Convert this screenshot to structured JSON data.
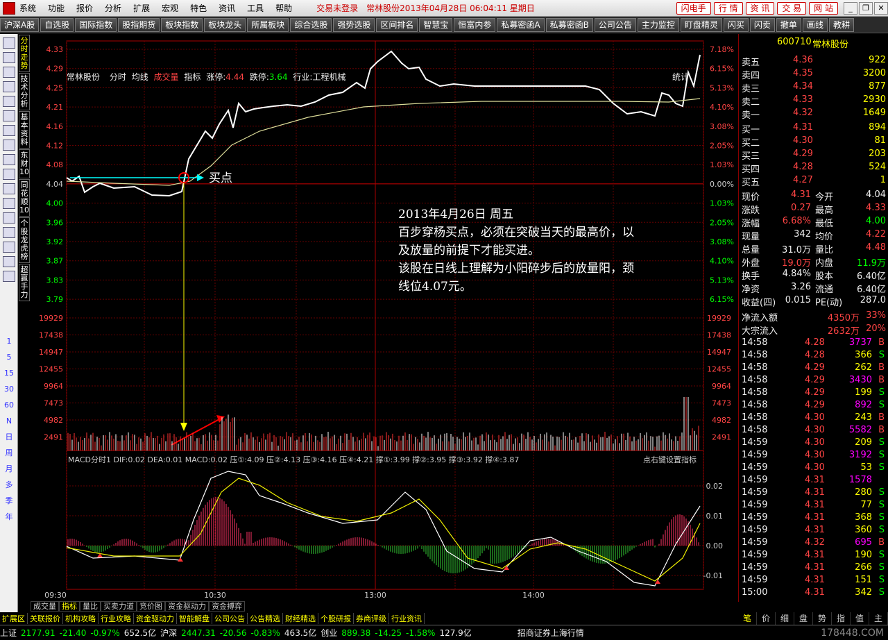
{
  "menu": [
    "系统",
    "功能",
    "报价",
    "分析",
    "扩展",
    "宏观",
    "特色",
    "资讯",
    "工具",
    "帮助"
  ],
  "status": "交易未登录",
  "window_title": "常林股份2013年04月28日 06:04:11 星期日",
  "quick_buttons": [
    "闪电手",
    "行 情",
    "资 讯",
    "交 易",
    "网 站"
  ],
  "toolbar": [
    "沪深A股",
    "自选股",
    "国际指数",
    "股指期货",
    "板块指数",
    "板块龙头",
    "所属板块",
    "综合选股",
    "强势选股",
    "区间排名",
    "智慧宝",
    "恒富内参",
    "私募密函A",
    "私募密函B",
    "公司公告",
    "主力监控",
    "盯盘精灵",
    "闪买",
    "闪卖",
    "撤单",
    "画线",
    "教耕"
  ],
  "left_tabs": [
    "分时走势",
    "技术分析",
    "基本资料",
    "东财10",
    "同花顺10",
    "个股龙虎榜",
    "超赢手力"
  ],
  "periods": [
    "1",
    "5",
    "15",
    "30",
    "60",
    "N",
    "日",
    "周",
    "月",
    "多",
    "季",
    "年"
  ],
  "chart_header": {
    "name": "常林股份",
    "mode": "分时",
    "avg": "均线",
    "vol": "成交量",
    "ind": "指标",
    "limit_up_label": "涨停:",
    "limit_up": "4.44",
    "limit_down_label": "跌停:",
    "limit_down": "3.64",
    "industry": "行业:工程机械",
    "stat": "统计"
  },
  "price_axis": [
    "4.33",
    "4.29",
    "4.25",
    "4.21",
    "4.16",
    "4.12",
    "4.08",
    "4.04",
    "4.00",
    "3.96",
    "3.92",
    "3.87",
    "3.83",
    "3.79"
  ],
  "pct_axis": [
    "7.18%",
    "6.15%",
    "5.13%",
    "4.10%",
    "3.08%",
    "2.05%",
    "1.03%",
    "0.00%",
    "1.03%",
    "2.05%",
    "3.08%",
    "4.10%",
    "5.13%",
    "6.15%"
  ],
  "vol_axis": [
    "19929",
    "17438",
    "14947",
    "12455",
    "9964",
    "7473",
    "4982",
    "2491"
  ],
  "macd_axis": [
    "0.02",
    "0.01",
    "0.00",
    "-0.01"
  ],
  "time_axis": [
    "09:30",
    "10:30",
    "13:00",
    "14:00"
  ],
  "macd_header": "MACD分时1  DIF:0.02  DEA:0.01  MACD:0.02  压①:4.09  压②:4.13  压③:4.16  压④:4.21  撑①:3.99  撑②:3.95  撑③:3.92  撑④:3.87",
  "macd_hint": "点右键设置指标",
  "buy_label": "买点",
  "annotation": {
    "date": "2013年4月26日  周五",
    "line1": "百步穿杨买点，必须在突破当天的最高价，以",
    "line2": "及放量的前提下才能买进。",
    "line3": "该股在日线上理解为小阳碎步后的放量阳，颈",
    "line4": "线位4.07元。"
  },
  "stock": {
    "code": "600710",
    "name": "常林股份"
  },
  "sell_levels": [
    {
      "label": "卖五",
      "price": "4.36",
      "vol": "922"
    },
    {
      "label": "卖四",
      "price": "4.35",
      "vol": "3200"
    },
    {
      "label": "卖三",
      "price": "4.34",
      "vol": "877"
    },
    {
      "label": "卖二",
      "price": "4.33",
      "vol": "2930"
    },
    {
      "label": "卖一",
      "price": "4.32",
      "vol": "1649"
    }
  ],
  "buy_levels": [
    {
      "label": "买一",
      "price": "4.31",
      "vol": "894"
    },
    {
      "label": "买二",
      "price": "4.30",
      "vol": "81"
    },
    {
      "label": "买三",
      "price": "4.29",
      "vol": "203"
    },
    {
      "label": "买四",
      "price": "4.28",
      "vol": "524"
    },
    {
      "label": "买五",
      "price": "4.27",
      "vol": "1"
    }
  ],
  "stats": [
    {
      "l1": "现价",
      "v1": "4.31",
      "l2": "今开",
      "v2": "4.04",
      "c1": "red",
      "c2": "white"
    },
    {
      "l1": "涨跌",
      "v1": "0.27",
      "l2": "最高",
      "v2": "4.33",
      "c1": "red",
      "c2": "red"
    },
    {
      "l1": "涨幅",
      "v1": "6.68%",
      "l2": "最低",
      "v2": "4.00",
      "c1": "red",
      "c2": "green"
    },
    {
      "l1": "现量",
      "v1": "342",
      "l2": "均价",
      "v2": "4.22",
      "c1": "white",
      "c2": "red"
    },
    {
      "l1": "总量",
      "v1": "31.0万",
      "l2": "量比",
      "v2": "4.48",
      "c1": "white",
      "c2": "red"
    },
    {
      "l1": "外盘",
      "v1": "19.0万",
      "l2": "内盘",
      "v2": "11.9万",
      "c1": "red",
      "c2": "green"
    },
    {
      "l1": "换手",
      "v1": "4.84%",
      "l2": "股本",
      "v2": "6.40亿",
      "c1": "white",
      "c2": "white"
    },
    {
      "l1": "净资",
      "v1": "3.26",
      "l2": "流通",
      "v2": "6.40亿",
      "c1": "white",
      "c2": "white"
    },
    {
      "l1": "收益(四)",
      "v1": "0.015",
      "l2": "PE(动)",
      "v2": "287.0",
      "c1": "white",
      "c2": "white"
    }
  ],
  "flows": [
    {
      "l": "净流入额",
      "v": "4350万",
      "p": "33%"
    },
    {
      "l": "大宗流入",
      "v": "2632万",
      "p": "20%"
    }
  ],
  "ticks": [
    {
      "t": "14:58",
      "p": "4.28",
      "v": "3737",
      "s": "B",
      "vc": "mag"
    },
    {
      "t": "14:58",
      "p": "4.28",
      "v": "366",
      "s": "S",
      "vc": "yellow"
    },
    {
      "t": "14:58",
      "p": "4.29",
      "v": "262",
      "s": "B",
      "vc": "yellow"
    },
    {
      "t": "14:58",
      "p": "4.29",
      "v": "3430",
      "s": "B",
      "vc": "mag"
    },
    {
      "t": "14:58",
      "p": "4.29",
      "v": "199",
      "s": "S",
      "vc": "yellow"
    },
    {
      "t": "14:58",
      "p": "4.29",
      "v": "892",
      "s": "S",
      "vc": "mag"
    },
    {
      "t": "14:58",
      "p": "4.30",
      "v": "243",
      "s": "B",
      "vc": "yellow"
    },
    {
      "t": "14:58",
      "p": "4.30",
      "v": "5582",
      "s": "B",
      "vc": "mag"
    },
    {
      "t": "14:59",
      "p": "4.30",
      "v": "209",
      "s": "S",
      "vc": "yellow"
    },
    {
      "t": "14:59",
      "p": "4.30",
      "v": "3192",
      "s": "S",
      "vc": "mag"
    },
    {
      "t": "14:59",
      "p": "4.30",
      "v": "53",
      "s": "S",
      "vc": "yellow"
    },
    {
      "t": "14:59",
      "p": "4.31",
      "v": "1578",
      "s": "",
      "vc": "mag"
    },
    {
      "t": "14:59",
      "p": "4.31",
      "v": "280",
      "s": "S",
      "vc": "yellow"
    },
    {
      "t": "14:59",
      "p": "4.31",
      "v": "77",
      "s": "S",
      "vc": "yellow"
    },
    {
      "t": "14:59",
      "p": "4.31",
      "v": "368",
      "s": "S",
      "vc": "yellow"
    },
    {
      "t": "14:59",
      "p": "4.31",
      "v": "360",
      "s": "S",
      "vc": "yellow"
    },
    {
      "t": "14:59",
      "p": "4.32",
      "v": "695",
      "s": "B",
      "vc": "mag"
    },
    {
      "t": "14:59",
      "p": "4.31",
      "v": "190",
      "s": "S",
      "vc": "yellow"
    },
    {
      "t": "14:59",
      "p": "4.31",
      "v": "266",
      "s": "S",
      "vc": "yellow"
    },
    {
      "t": "14:59",
      "p": "4.31",
      "v": "151",
      "s": "S",
      "vc": "yellow"
    },
    {
      "t": "15:00",
      "p": "4.31",
      "v": "342",
      "s": "S",
      "vc": "yellow"
    }
  ],
  "bottom_tabs": [
    "成交量",
    "指标",
    "量比",
    "买卖力道",
    "竞价图",
    "资金驱动力",
    "资金搏弈"
  ],
  "right_tabs": [
    "笔",
    "价",
    "细",
    "盘",
    "势",
    "指",
    "值",
    "主"
  ],
  "func_tabs": [
    "扩展区",
    "关联报价",
    "机构攻略",
    "行业攻略",
    "资金驱动力",
    "智能解盘",
    "公司公告",
    "公告精选",
    "财经精选",
    "个股研报",
    "券商评级",
    "行业资讯"
  ],
  "indexes": [
    {
      "name": "上证",
      "val": "2177.91",
      "chg": "-21.40",
      "pct": "-0.97%",
      "amt": "652.5亿"
    },
    {
      "name": "沪深",
      "val": "2447.31",
      "chg": "-20.56",
      "pct": "-0.83%",
      "amt": "463.5亿"
    },
    {
      "name": "创业",
      "val": "889.38",
      "chg": "-14.25",
      "pct": "-1.58%",
      "amt": "127.9亿"
    }
  ],
  "broker": "招商证券上海行情",
  "watermark": "178448.COM"
}
